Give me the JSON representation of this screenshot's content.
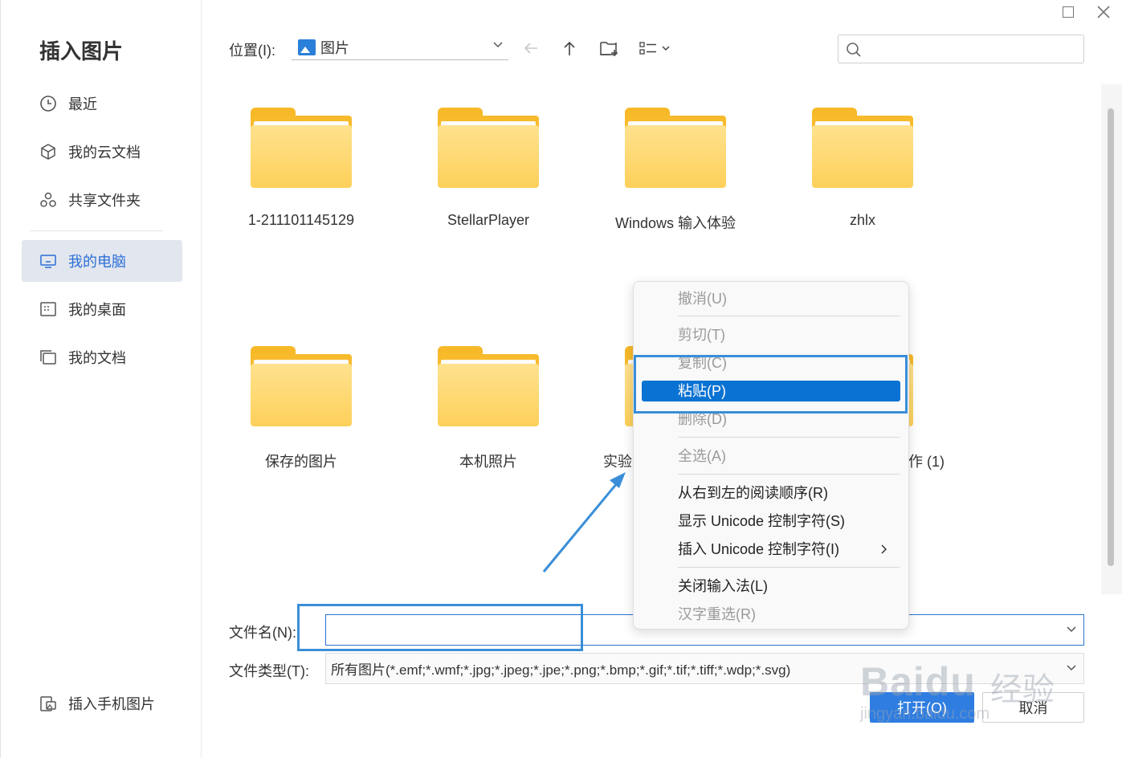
{
  "dialog": {
    "title": "插入图片",
    "window_controls": {
      "maximize": "maximize-icon",
      "close": "close-icon"
    }
  },
  "sidebar": {
    "items": [
      {
        "label": "最近",
        "icon": "clock-icon"
      },
      {
        "label": "我的云文档",
        "icon": "cube-icon"
      },
      {
        "label": "共享文件夹",
        "icon": "share-icon"
      },
      {
        "label": "我的电脑",
        "icon": "monitor-icon",
        "active": true
      },
      {
        "label": "我的桌面",
        "icon": "desktop-icon"
      },
      {
        "label": "我的文档",
        "icon": "documents-icon"
      }
    ],
    "bottom_item": {
      "label": "插入手机图片",
      "icon": "phone-image-icon"
    }
  },
  "toolbar": {
    "location_label": "位置(I):",
    "location_value": "图片",
    "back_icon": "arrow-left-icon",
    "up_icon": "arrow-up-icon",
    "new_folder_icon": "new-folder-icon",
    "view_icon": "list-view-icon",
    "search_placeholder": ""
  },
  "files": [
    {
      "name": "1-211101145129",
      "type": "folder"
    },
    {
      "name": "StellarPlayer",
      "type": "folder"
    },
    {
      "name": "Windows 输入体验",
      "type": "folder"
    },
    {
      "name": "zhlx",
      "type": "folder"
    },
    {
      "name": "保存的图片",
      "type": "folder"
    },
    {
      "name": "本机照片",
      "type": "folder"
    },
    {
      "name": "实验",
      "type": "folder"
    },
    {
      "name": "作 (1)",
      "type": "folder"
    }
  ],
  "footer": {
    "filename_label": "文件名(N):",
    "filename_value": "",
    "filetype_label": "文件类型(T):",
    "filetype_value": "所有图片(*.emf;*.wmf;*.jpg;*.jpeg;*.jpe;*.png;*.bmp;*.gif;*.tif;*.tiff;*.wdp;*.svg)",
    "open_label": "打开(O)",
    "cancel_label": "取消"
  },
  "context_menu": {
    "items": [
      {
        "label": "撤消(U)",
        "enabled": false
      },
      {
        "label": "剪切(T)",
        "enabled": false
      },
      {
        "label": "复制(C)",
        "enabled": false
      },
      {
        "label": "粘贴(P)",
        "enabled": true,
        "highlighted": true
      },
      {
        "label": "删除(D)",
        "enabled": false
      },
      {
        "label": "全选(A)",
        "enabled": false
      },
      {
        "label": "从右到左的阅读顺序(R)",
        "enabled": true
      },
      {
        "label": "显示 Unicode 控制字符(S)",
        "enabled": true
      },
      {
        "label": "插入 Unicode 控制字符(I)",
        "enabled": true,
        "submenu": true
      },
      {
        "label": "关闭输入法(L)",
        "enabled": true
      },
      {
        "label": "汉字重选(R)",
        "enabled": false
      }
    ]
  },
  "watermark": {
    "logo_text": "Baidu",
    "cn_text": "经验",
    "url": "jingyan.baidu.com"
  },
  "colors": {
    "accent": "#2f7de1",
    "highlight": "#0a72d2",
    "annotation": "#3a8ed8",
    "folder": "#f8bb2c"
  }
}
